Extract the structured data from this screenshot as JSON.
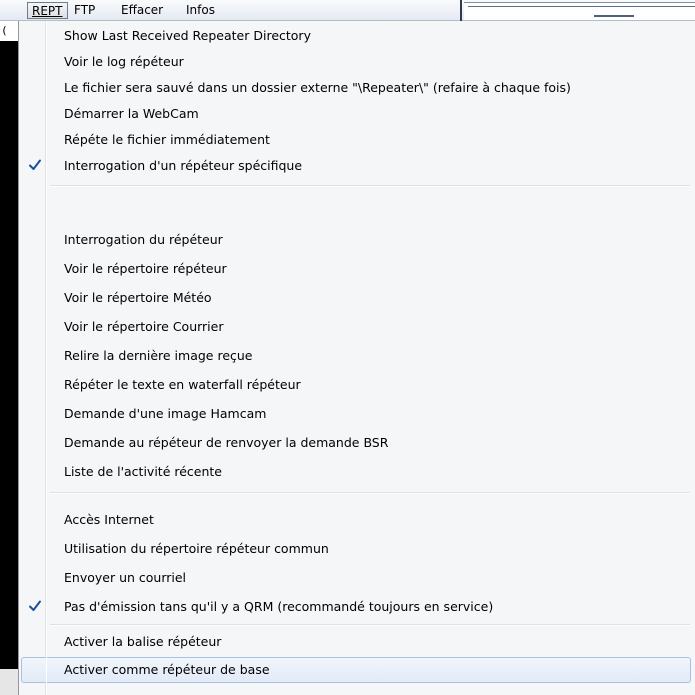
{
  "menubar": {
    "items": [
      {
        "label": "REPT",
        "active": true
      },
      {
        "label": "FTP",
        "active": false
      },
      {
        "label": "Effacer",
        "active": false
      },
      {
        "label": "Infos",
        "active": false
      }
    ]
  },
  "background_window": {
    "visible_char": "("
  },
  "menu": {
    "items": [
      {
        "label": "Show Last Received Repeater Directory",
        "checked": false
      },
      {
        "label": "Voir le log répéteur",
        "checked": false
      },
      {
        "label": "Le fichier sera sauvé dans un dossier externe \"\\Repeater\\\" (refaire à chaque fois)",
        "checked": false
      },
      {
        "label": "Démarrer la WebCam",
        "checked": false
      },
      {
        "label": "Répéte le fichier immédiatement",
        "checked": false
      },
      {
        "label": "Interrogation d'un répéteur spécifique",
        "checked": true
      },
      {
        "label": "Interrogation du répéteur",
        "checked": false
      },
      {
        "label": "Voir le répertoire répéteur",
        "checked": false
      },
      {
        "label": "Voir le répertoire Météo",
        "checked": false
      },
      {
        "label": "Voir le répertoire Courrier",
        "checked": false
      },
      {
        "label": "Relire la dernière image reçue",
        "checked": false
      },
      {
        "label": "Répéter le texte en waterfall répéteur",
        "checked": false
      },
      {
        "label": "Demande d'une image Hamcam",
        "checked": false
      },
      {
        "label": "Demande au répéteur de renvoyer la demande BSR",
        "checked": false
      },
      {
        "label": "Liste de l'activité récente",
        "checked": false
      },
      {
        "label": "Accès Internet",
        "checked": false
      },
      {
        "label": "Utilisation du répertoire répéteur commun",
        "checked": false
      },
      {
        "label": "Envoyer un courriel",
        "checked": false
      },
      {
        "label": "Pas d'émission tans qu'il y a QRM (recommandé toujours en service)",
        "checked": true
      },
      {
        "label": "Activer la balise répéteur",
        "checked": false
      },
      {
        "label": "Activer comme répéteur de base",
        "checked": false,
        "highlighted": true
      }
    ]
  },
  "colors": {
    "check_mark": "#1a4fa0",
    "highlight_border": "#a8c2e2",
    "menu_background": "#f5f6f7"
  }
}
